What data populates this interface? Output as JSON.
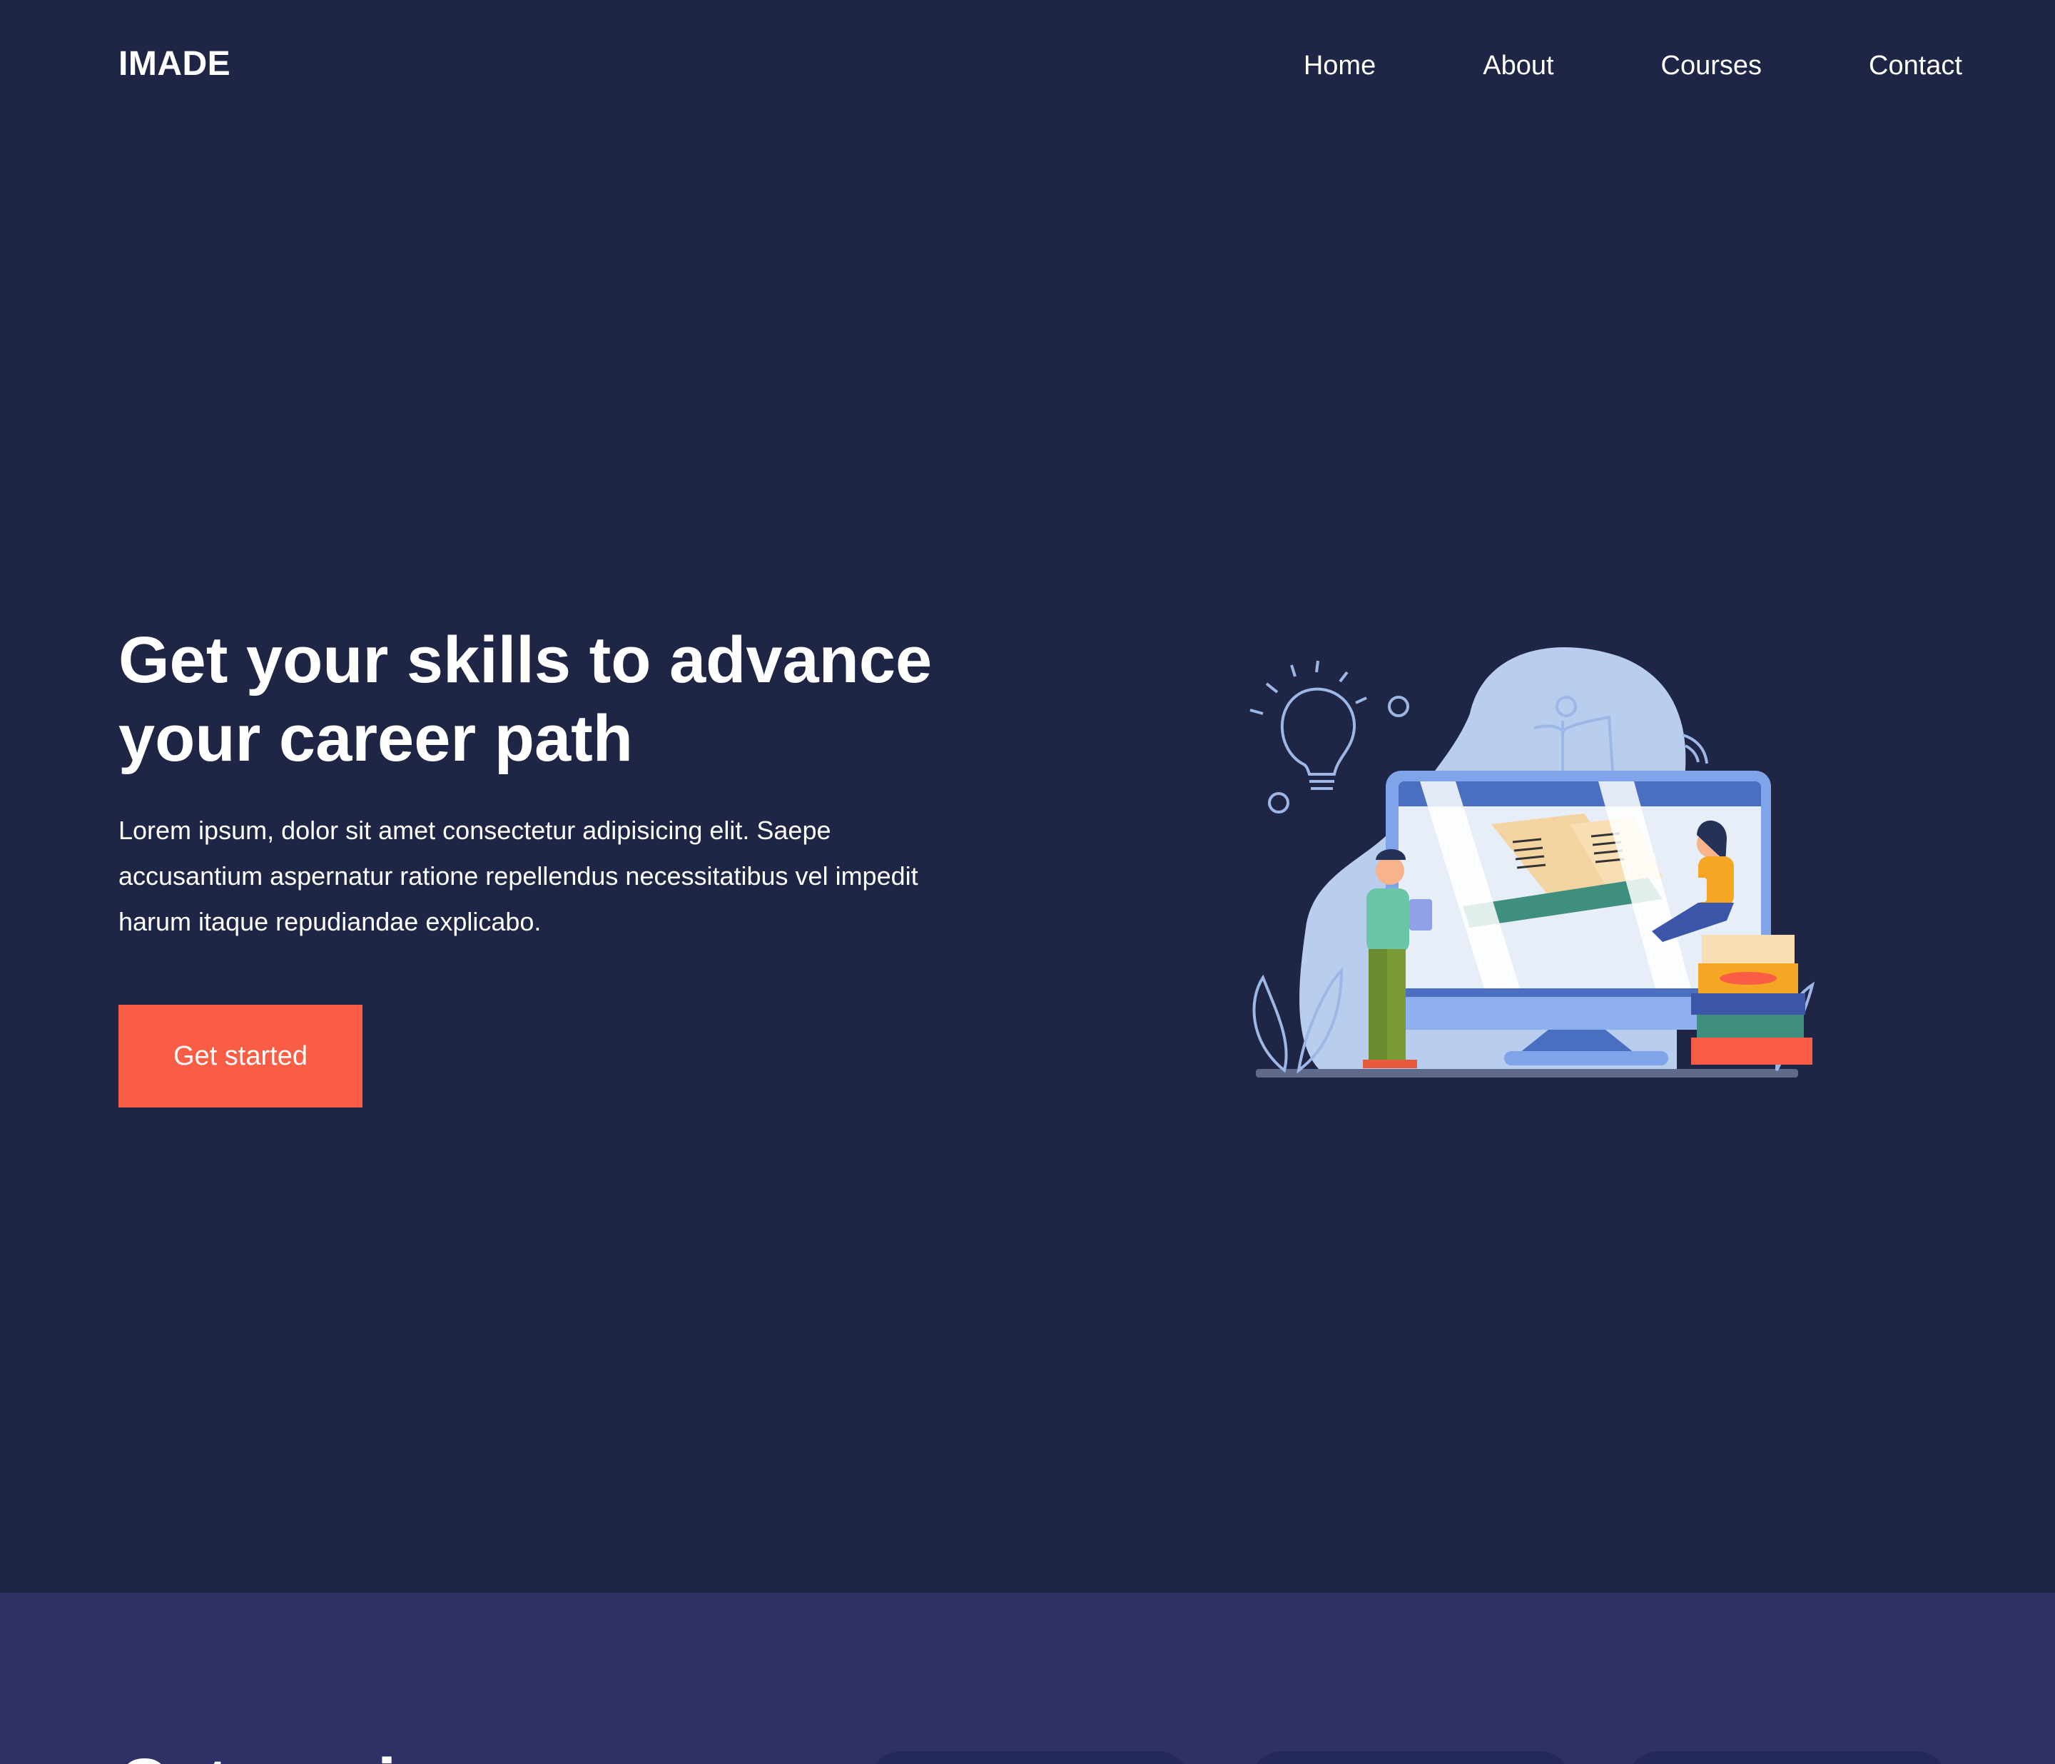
{
  "brand": {
    "logo": "IMADE"
  },
  "nav": {
    "items": [
      "Home",
      "About",
      "Courses",
      "Contact"
    ]
  },
  "hero": {
    "title": "Get your skills to advance your career path",
    "description": "Lorem ipsum, dolor sit amet consectetur adipisicing elit. Saepe accusantium aspernatur ratione repellendus necessitatibus vel impedit harum itaque repudiandae explicabo.",
    "cta_label": "Get started",
    "illustration_icon": "e-learning-illustration"
  },
  "section2": {
    "title": "Categories"
  },
  "colors": {
    "background": "#1f2544",
    "section2_background": "#2f3166",
    "accent": "#f95d45",
    "text": "#ffffff"
  }
}
